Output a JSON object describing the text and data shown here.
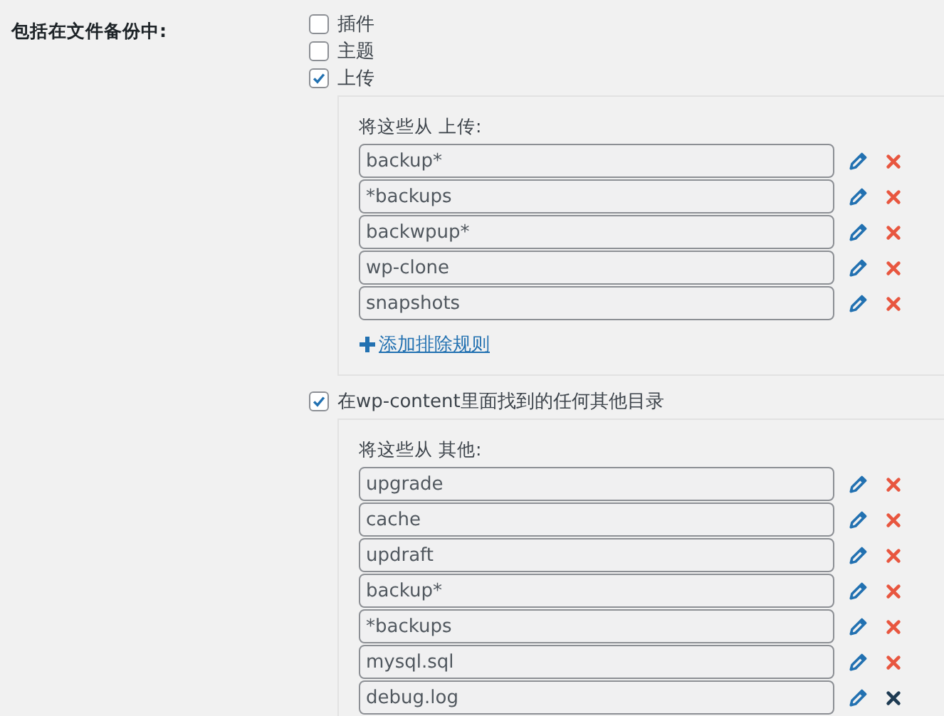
{
  "section_label": "包括在文件备份中:",
  "options": [
    {
      "label": "插件",
      "checked": false
    },
    {
      "label": "主题",
      "checked": false
    },
    {
      "label": "上传",
      "checked": true,
      "exclusions": {
        "heading": "将这些从 上传:",
        "add_link": "添加排除规则",
        "rules": [
          {
            "value": "backup*",
            "hovered": false
          },
          {
            "value": "*backups",
            "hovered": false
          },
          {
            "value": "backwpup*",
            "hovered": false
          },
          {
            "value": "wp-clone",
            "hovered": false
          },
          {
            "value": "snapshots",
            "hovered": false
          }
        ]
      }
    },
    {
      "label": "在wp-content里面找到的任何其他目录",
      "checked": true,
      "exclusions": {
        "heading": "将这些从 其他:",
        "rules": [
          {
            "value": "upgrade",
            "hovered": false
          },
          {
            "value": "cache",
            "hovered": false
          },
          {
            "value": "updraft",
            "hovered": false
          },
          {
            "value": "backup*",
            "hovered": false
          },
          {
            "value": "*backups",
            "hovered": false
          },
          {
            "value": "mysql.sql",
            "hovered": false
          },
          {
            "value": "debug.log",
            "hovered": true
          }
        ]
      }
    }
  ]
}
